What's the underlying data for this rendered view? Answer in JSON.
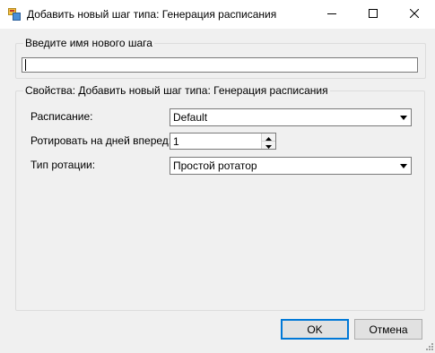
{
  "window": {
    "title": "Добавить новый шаг типа: Генерация расписания",
    "app_icon": "app-dialog-icon",
    "controls": {
      "minimize": "minimize-icon",
      "maximize": "maximize-icon",
      "close": "close-icon"
    }
  },
  "name_group": {
    "legend": "Введите имя нового шага",
    "input_value": ""
  },
  "props_group": {
    "legend": "Свойства: Добавить новый шаг типа: Генерация расписания",
    "schedule": {
      "label": "Расписание:",
      "value": "Default"
    },
    "rotate_days": {
      "label": "Ротировать на дней вперед:",
      "value": "1"
    },
    "rotation_type": {
      "label": "Тип ротации:",
      "value": "Простой ротатор"
    }
  },
  "buttons": {
    "ok": "OK",
    "cancel": "Отмена"
  },
  "colors": {
    "title_bg": "#ffffff",
    "dialog_bg": "#f0f0f0",
    "focus_border": "#0078d7"
  }
}
